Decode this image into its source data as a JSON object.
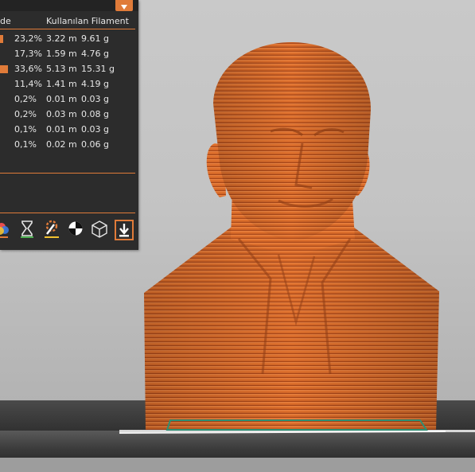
{
  "table": {
    "header_left": "de",
    "header_filament": "Kullanılan Filament",
    "rows": [
      {
        "pct": "23,2%",
        "length": "3.22 m",
        "weight": "9.61 g",
        "swatch": true
      },
      {
        "pct": "17,3%",
        "length": "1.59 m",
        "weight": "4.76 g",
        "swatch": false
      },
      {
        "pct": "33,6%",
        "length": "5.13 m",
        "weight": "15.31 g",
        "swatch": true
      },
      {
        "pct": "11,4%",
        "length": "1.41 m",
        "weight": "4.19 g",
        "swatch": false
      },
      {
        "pct": "0,2%",
        "length": "0.01 m",
        "weight": "0.03 g",
        "swatch": false
      },
      {
        "pct": "0,2%",
        "length": "0.03 m",
        "weight": "0.08 g",
        "swatch": false
      },
      {
        "pct": "0,1%",
        "length": "0.01 m",
        "weight": "0.03 g",
        "swatch": false
      },
      {
        "pct": "0,1%",
        "length": "0.02 m",
        "weight": "0.06 g",
        "swatch": false
      }
    ]
  },
  "toolbar": {
    "icons": [
      "color-wheel-icon",
      "hourglass-icon",
      "paint-icon",
      "half-circle-icon",
      "cube-icon",
      "export-icon"
    ]
  },
  "colors": {
    "accent": "#e07b39",
    "model": "#d9692a",
    "panel_bg": "#2c2c2c",
    "viewport_bg": "#c3c3c3"
  }
}
